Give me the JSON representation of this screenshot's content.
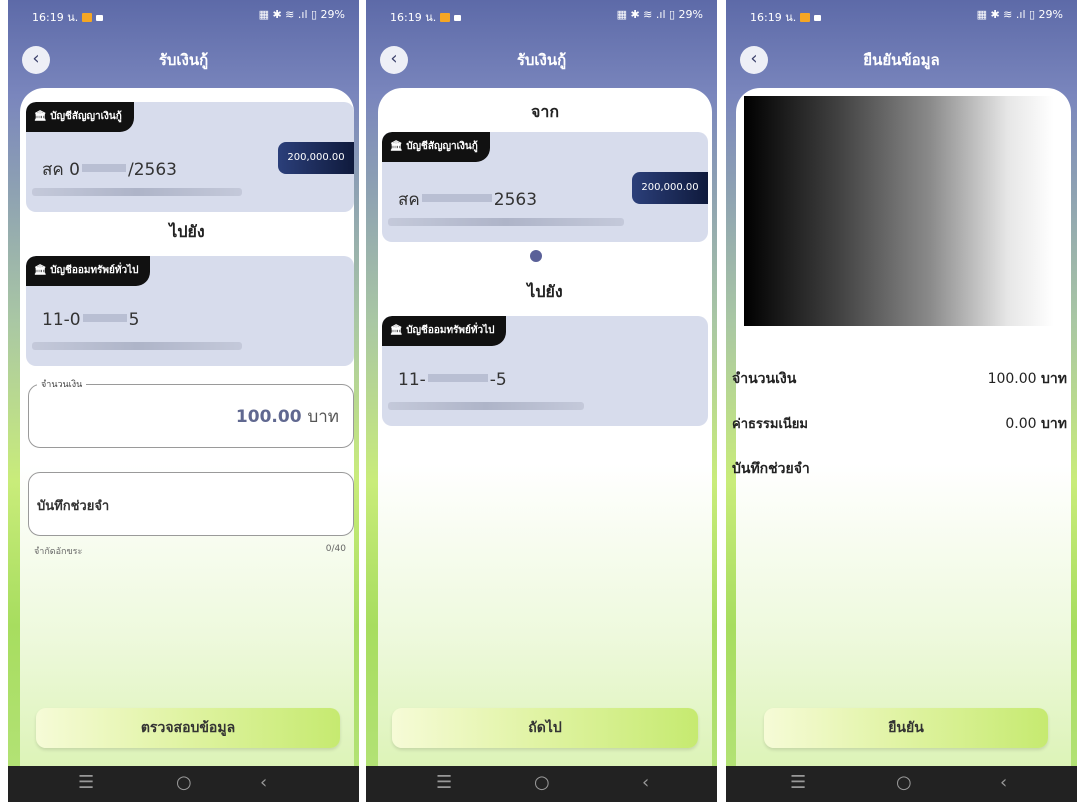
{
  "status": {
    "time": "16:19 น.",
    "right": "▦ ✱ ≋ .ıl ▯ 29%"
  },
  "screen1": {
    "title": "รับเงินกู้",
    "from_tag": "บัญชีสัญญาเงินกู้",
    "from_acct_prefix": "สค 0",
    "from_acct_suffix": "/2563",
    "from_amount": "200,000.00",
    "to_heading": "ไปยัง",
    "to_tag": "บัญชีออมทรัพย์ทั่วไป",
    "to_acct_prefix": "11-0",
    "to_acct_suffix": "5",
    "amount_legend": "จำนวนเงิน",
    "amount_value": "100.00",
    "amount_unit": "บาท",
    "memo_label": "บันทึกช่วยจำ",
    "limit_label": "จำกัดอักขระ",
    "limit_count": "0/40",
    "button": "ตรวจสอบข้อมูล"
  },
  "screen2": {
    "title": "รับเงินกู้",
    "from_heading": "จาก",
    "from_tag": "บัญชีสัญญาเงินกู้",
    "from_acct_prefix": "สค",
    "from_acct_suffix": "2563",
    "from_amount": "200,000.00",
    "to_heading": "ไปยัง",
    "to_tag": "บัญชีออมทรัพย์ทั่วไป",
    "to_acct_prefix": "11-",
    "to_acct_suffix": "-5",
    "button": "ถัดไป"
  },
  "screen3": {
    "title": "ยืนยันข้อมูล",
    "amount_label": "จำนวนเงิน",
    "amount_value": "100.00",
    "amount_unit": "บาท",
    "fee_label": "ค่าธรรมเนียม",
    "fee_value": "0.00",
    "fee_unit": "บาท",
    "memo_label": "บันทึกช่วยจำ",
    "button": "ยืนยัน"
  },
  "nav": {
    "menu": "☰",
    "home": "○",
    "back": "‹"
  },
  "icons": {
    "back": "chevron-left-icon",
    "bank": "bank-icon"
  }
}
